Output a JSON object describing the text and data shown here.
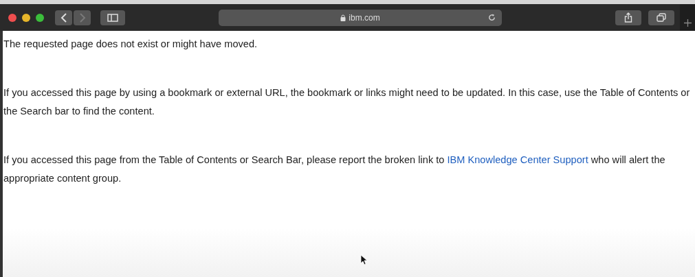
{
  "browser": {
    "address": "ibm.com",
    "back_disabled": false,
    "forward_disabled": true
  },
  "paragraphs": [
    {
      "text": "The requested page does not exist or might have moved."
    },
    {
      "text": "If you accessed this page by using a bookmark or external URL, the bookmark or links might need to be updated. In this case, use the Table of Contents or the Search bar to find the content."
    },
    {
      "text": "If you accessed this page from the Table of Contents or Search Bar, please report the broken link to ",
      "link": "IBM Knowledge Center Support",
      "after": " who will alert the appropriate content group."
    }
  ]
}
